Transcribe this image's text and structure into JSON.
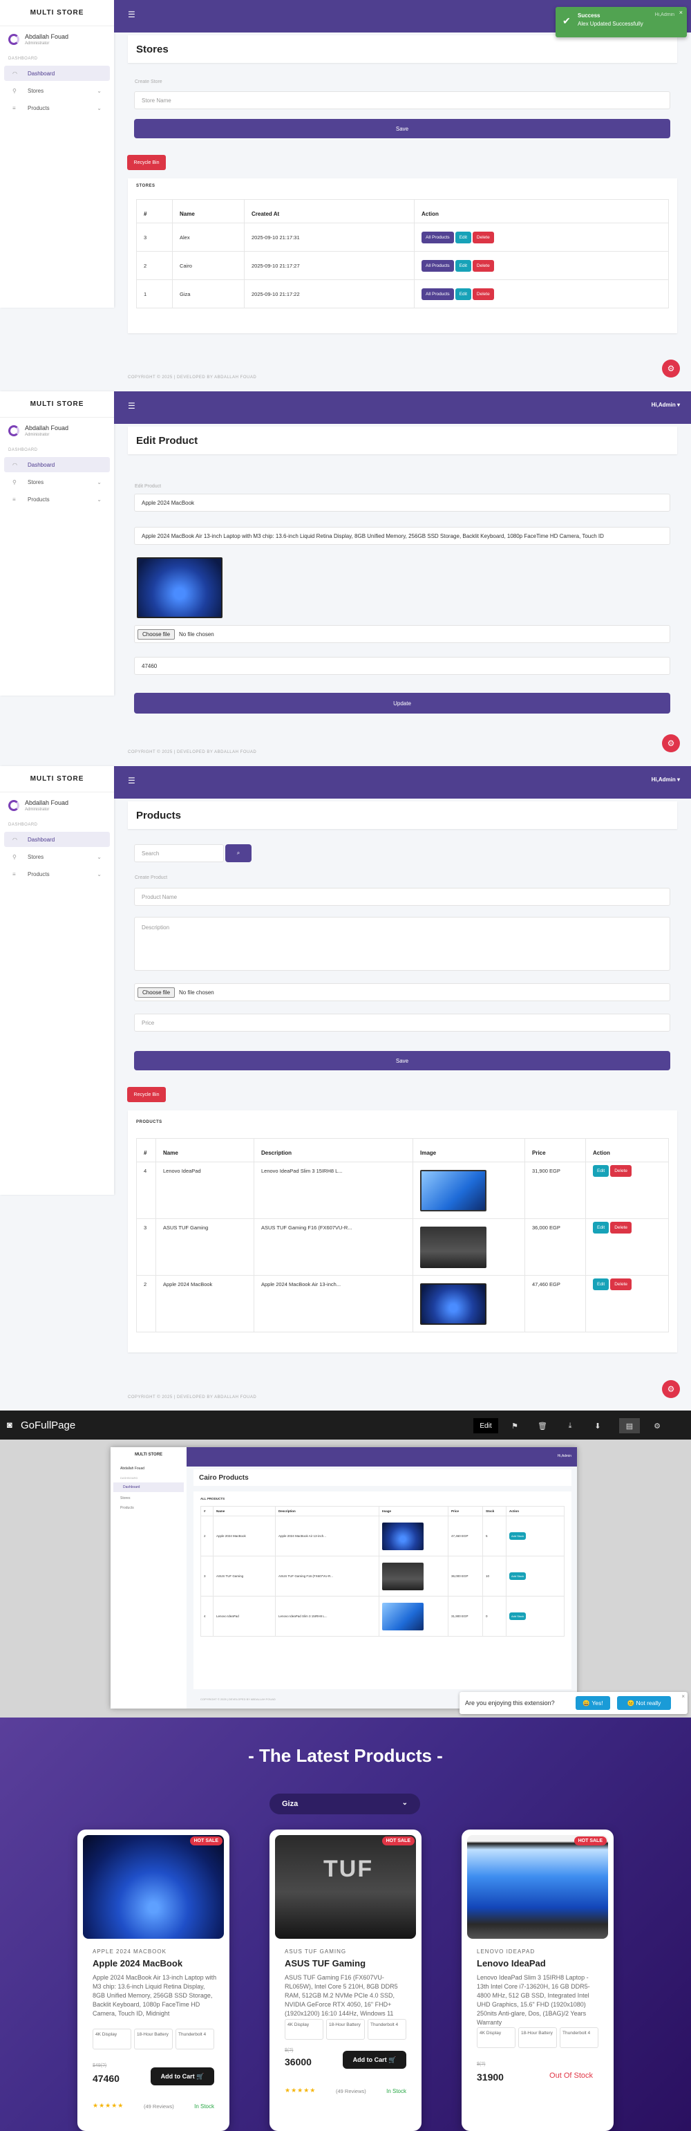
{
  "brand": "MULTI STORE",
  "user": {
    "name": "Abdallah Fouad",
    "role": "Administrator"
  },
  "nav": {
    "section": "DASHBOARD",
    "dashboard": "Dashboard",
    "stores": "Stores",
    "products": "Products"
  },
  "header": {
    "admin": "Hi,Admin"
  },
  "footer": "COPYRIGHT © 2025 | DEVELOPED BY ABDALLAH FOUAD",
  "toast": {
    "title": "Success",
    "message": "Alex Updated Successfully",
    "close": "×",
    "hint": "Hi,Admin"
  },
  "stores_page": {
    "title": "Stores",
    "create_label": "Create Store",
    "name_placeholder": "Store Name",
    "save": "Save",
    "recycle": "Recycle Bin",
    "table_title": "STORES",
    "columns": [
      "#",
      "Name",
      "Created At",
      "Action"
    ],
    "rows": [
      {
        "id": "3",
        "name": "Alex",
        "created": "2025-09-10 21:17:31"
      },
      {
        "id": "2",
        "name": "Cairo",
        "created": "2025-09-10 21:17:27"
      },
      {
        "id": "1",
        "name": "Giza",
        "created": "2025-09-10 21:17:22"
      }
    ],
    "actions": {
      "all_products": "All Products",
      "edit": "Edit",
      "delete": "Delete"
    }
  },
  "edit_page": {
    "title": "Edit Product",
    "label": "Edit Product",
    "name_value": "Apple 2024 MacBook",
    "desc_value": "Apple 2024 MacBook Air 13-inch Laptop with M3 chip: 13.6-inch Liquid Retina Display, 8GB Unified Memory, 256GB SSD Storage, Backlit Keyboard, 1080p FaceTime HD Camera, Touch ID",
    "file_button": "Choose file",
    "file_status": "No file chosen",
    "price_value": "47460",
    "update": "Update"
  },
  "products_page": {
    "title": "Products",
    "search_placeholder": "Search",
    "create_label": "Create Product",
    "name_placeholder": "Product Name",
    "desc_placeholder": "Description",
    "file_button": "Choose file",
    "file_status": "No file chosen",
    "price_placeholder": "Price",
    "save": "Save",
    "recycle": "Recycle Bin",
    "table_title": "PRODUCTS",
    "columns": [
      "#",
      "Name",
      "Description",
      "Image",
      "Price",
      "Action"
    ],
    "rows": [
      {
        "id": "4",
        "name": "Lenovo IdeaPad",
        "desc": "Lenovo IdeaPad Slim 3 15IRH8 L...",
        "price": "31,900 EGP"
      },
      {
        "id": "3",
        "name": "ASUS TUF Gaming",
        "desc": "ASUS TUF Gaming F16 (FX607VU-R...",
        "price": "36,000 EGP"
      },
      {
        "id": "2",
        "name": "Apple 2024 MacBook",
        "desc": "Apple 2024 MacBook Air 13-inch...",
        "price": "47,460 EGP"
      }
    ],
    "actions": {
      "edit": "Edit",
      "delete": "Delete"
    }
  },
  "gofullpage": {
    "name": "GoFullPage",
    "edit": "Edit"
  },
  "preview": {
    "title": "Cairo Products",
    "table_title": "ALL PRODUCTS",
    "columns": [
      "#",
      "Name",
      "Description",
      "Image",
      "Price",
      "Stock",
      "Action"
    ],
    "rows": [
      {
        "id": "2",
        "name": "Apple 2024 MacBook",
        "desc": "Apple 2024 MacBook Air 13-inch...",
        "price": "47,460 EGP",
        "stock": "5"
      },
      {
        "id": "3",
        "name": "ASUS TUF Gaming",
        "desc": "ASUS TUF Gaming F16 (FX607VU-R...",
        "price": "36,000 EGP",
        "stock": "10"
      },
      {
        "id": "4",
        "name": "Lenovo IdeaPad",
        "desc": "Lenovo IdeaPad Slim 3 15IRH8 L...",
        "price": "31,900 EGP",
        "stock": "0"
      }
    ],
    "action": "Add Stock"
  },
  "survey": {
    "question": "Are you enjoying this extension?",
    "yes": "Yes!",
    "no": "Not really"
  },
  "storefront": {
    "title": "- The Latest Products -",
    "store_select": "Giza",
    "hot": "HOT SALE",
    "add_to_cart": "Add to Cart",
    "products": [
      {
        "category": "APPLE 2024 MACBOOK",
        "name": "Apple 2024 MacBook",
        "desc": "Apple 2024 MacBook Air 13-inch Laptop with M3 chip: 13.6-inch Liquid Retina Display, 8GB Unified Memory, 256GB SSD Storage, Backlit Keyboard, 1080p FaceTime HD Camera, Touch ID, Midnight",
        "specs": [
          "4K Display",
          "18-Hour Battery",
          "Thunderbolt 4"
        ],
        "old_price": "$49(?)",
        "price": "47460",
        "reviews": "(49 Reviews)",
        "status": "In Stock"
      },
      {
        "category": "ASUS TUF GAMING",
        "name": "ASUS TUF Gaming",
        "desc": "ASUS TUF Gaming F16 (FX607VU-RL065W), Intel Core 5 210H, 8GB DDR5 RAM, 512GB M.2 NVMe PCIe 4.0 SSD, NVIDIA GeForce RTX 4050, 16\" FHD+ (1920x1200) 16:10 144Hz, Windows 11",
        "specs": [
          "4K Display",
          "18-Hour Battery",
          "Thunderbolt 4"
        ],
        "old_price": "$(?)",
        "price": "36000",
        "reviews": "(49 Reviews)",
        "status": "In Stock"
      },
      {
        "category": "LENOVO IDEAPAD",
        "name": "Lenovo IdeaPad",
        "desc": "Lenovo IdeaPad Slim 3 15IRH8 Laptop - 13th Intel Core i7-13620H, 16 GB DDR5-4800 MHz, 512 GB SSD, Integrated Intel UHD Graphics, 15.6\" FHD (1920x1080) 250nits Anti-glare, Dos, (1BAG)/2 Years Warranty",
        "specs": [
          "4K Display",
          "18-Hour Battery",
          "Thunderbolt 4"
        ],
        "old_price": "$(?)",
        "price": "31900",
        "status": "Out Of Stock"
      }
    ]
  }
}
